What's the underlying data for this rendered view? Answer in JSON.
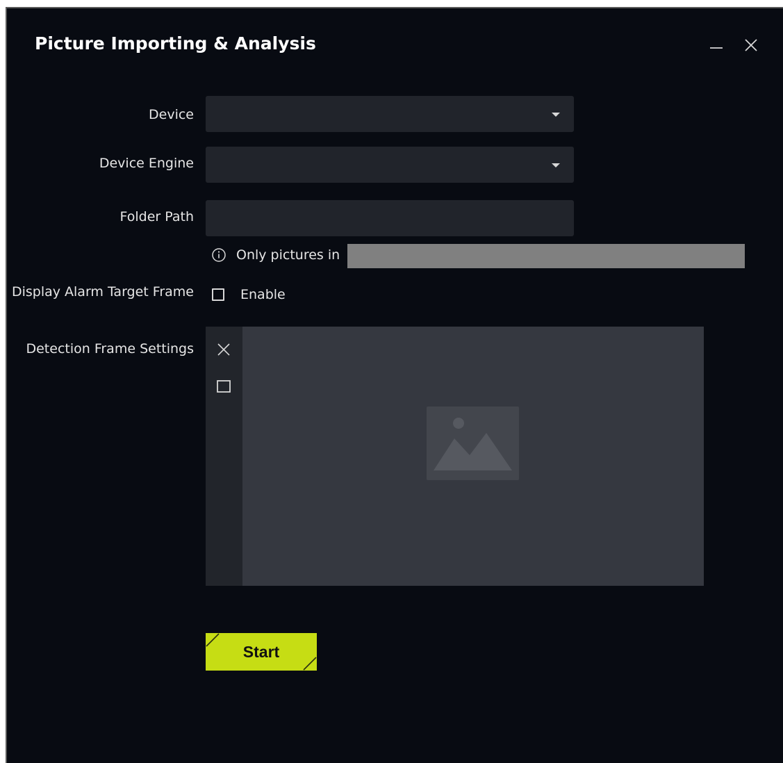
{
  "window": {
    "title": "Picture Importing & Analysis"
  },
  "form": {
    "device_label": "Device",
    "device_value": "",
    "engine_label": "Device Engine",
    "engine_value": "",
    "folder_label": "Folder Path",
    "folder_value": "",
    "folder_placeholder": "",
    "hint_text": "Only pictures in",
    "alarm_label": "Display Alarm Target Frame",
    "alarm_checkbox_label": "Enable",
    "alarm_checked": false,
    "detection_label": "Detection Frame Settings"
  },
  "actions": {
    "start_label": "Start"
  },
  "colors": {
    "background": "#080b12",
    "field": "#21242b",
    "panel": "#353840",
    "accent": "#c6dd14"
  },
  "icons": {
    "minimize": "minimize-icon",
    "close": "close-icon",
    "dropdown": "chevron-down-icon",
    "info": "info-icon",
    "clear": "close-icon",
    "draw_rect": "rectangle-icon",
    "placeholder": "image-placeholder-icon"
  }
}
